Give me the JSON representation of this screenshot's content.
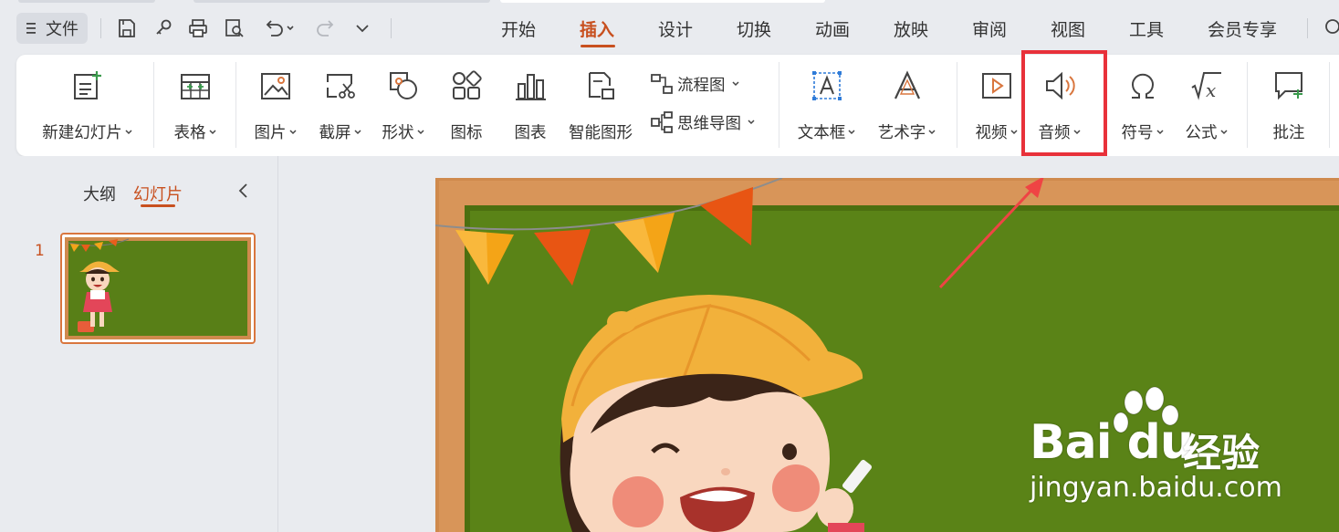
{
  "menubar": {
    "file_label": "文件",
    "tabs": [
      "开始",
      "插入",
      "设计",
      "切换",
      "动画",
      "放映",
      "审阅",
      "视图",
      "工具",
      "会员专享"
    ],
    "active_tab": "插入",
    "accent_color": "#c8501f"
  },
  "quick_access": {
    "icons": [
      "save-icon",
      "link-icon",
      "print-icon",
      "print-preview-icon",
      "undo-icon",
      "redo-icon",
      "more-icon"
    ]
  },
  "ribbon": {
    "new_slide": "新建幻灯片",
    "table": "表格",
    "picture": "图片",
    "screenshot": "截屏",
    "shape": "形状",
    "icon": "图标",
    "chart": "图表",
    "smart_art": "智能图形",
    "flowchart": "流程图",
    "mindmap": "思维导图",
    "textbox": "文本框",
    "wordart": "艺术字",
    "video": "视频",
    "audio": "音频",
    "symbol": "符号",
    "formula": "公式",
    "comment": "批注"
  },
  "highlight": {
    "target": "音频",
    "color": "#e8313a"
  },
  "left_panel": {
    "tabs": [
      "大纲",
      "幻灯片"
    ],
    "active_tab": "幻灯片",
    "slides": [
      {
        "number": "1"
      }
    ]
  },
  "watermark": {
    "brand": "Bai du",
    "cn": "经验",
    "url": "jingyan.baidu.com"
  }
}
